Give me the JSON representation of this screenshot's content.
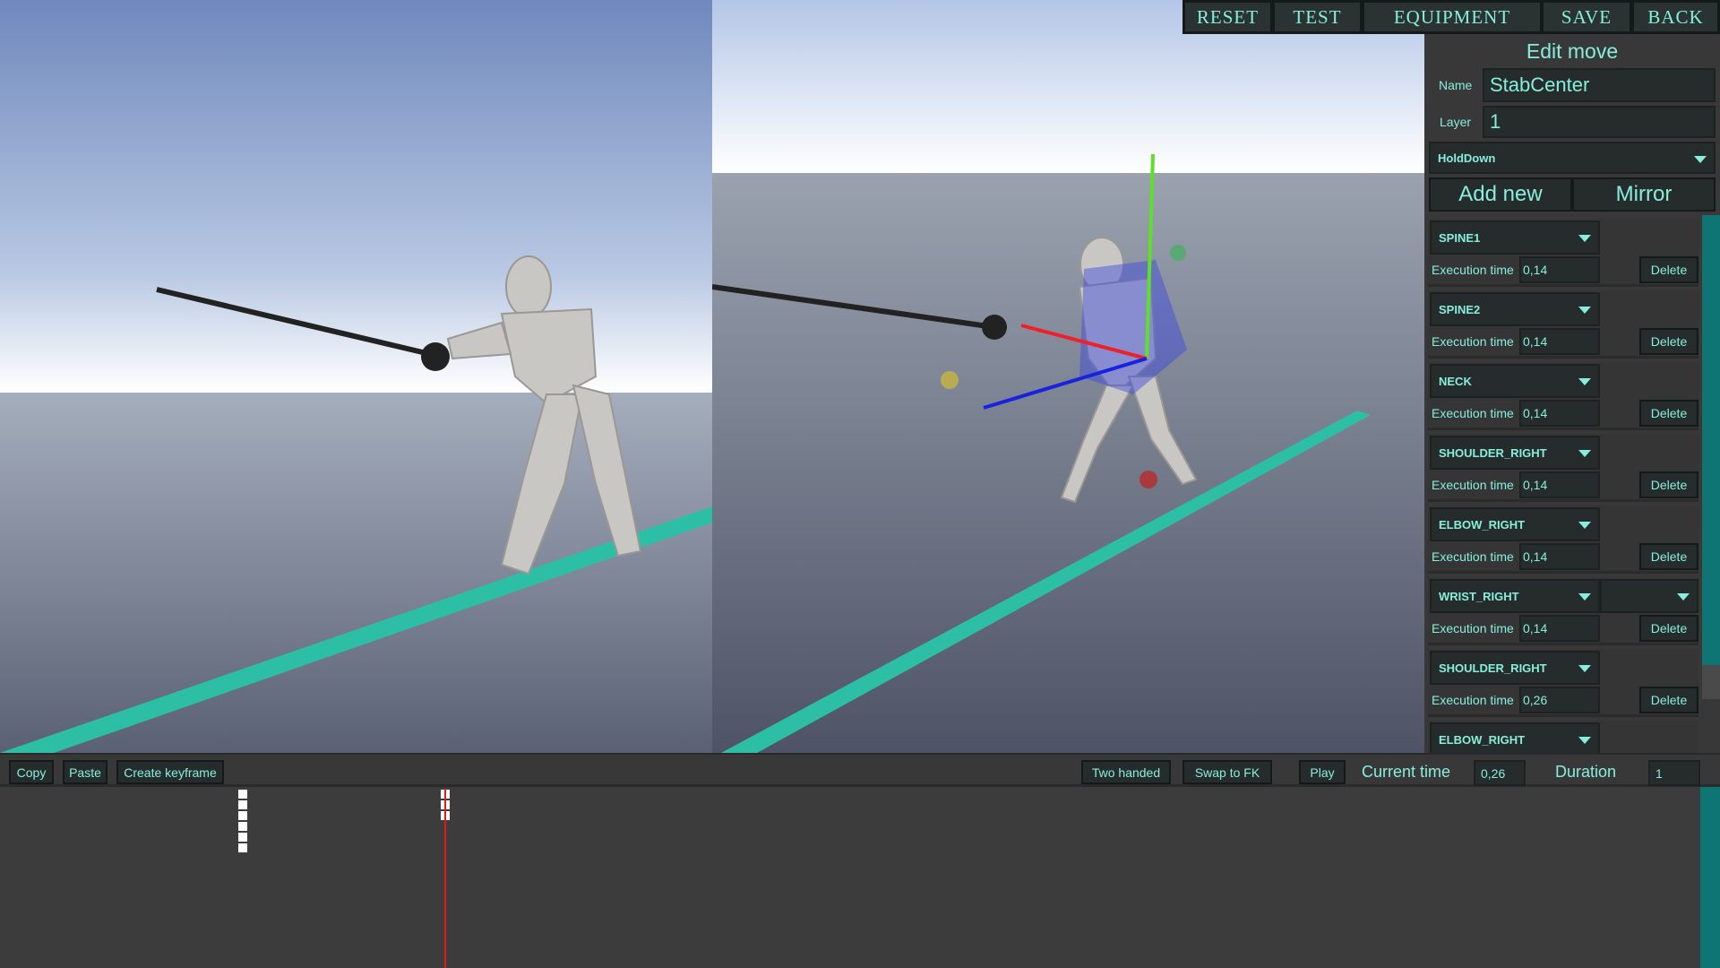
{
  "toolbar": {
    "reset": "RESET",
    "test": "TEST",
    "equipment": "EQUIPMENT",
    "save": "SAVE",
    "back": "BACK"
  },
  "panel": {
    "title": "Edit move",
    "name_label": "Name",
    "name_value": "StabCenter",
    "layer_label": "Layer",
    "layer_value": "1",
    "mode_value": "HoldDown",
    "add_new": "Add new",
    "mirror": "Mirror",
    "exec_label": "Execution time",
    "delete_label": "Delete",
    "items": [
      {
        "bone": "SPINE1",
        "time": "0,14"
      },
      {
        "bone": "SPINE2",
        "time": "0,14"
      },
      {
        "bone": "NECK",
        "time": "0,14"
      },
      {
        "bone": "SHOULDER_RIGHT",
        "time": "0,14"
      },
      {
        "bone": "ELBOW_RIGHT",
        "time": "0,14"
      },
      {
        "bone": "WRIST_RIGHT",
        "time": "0,14",
        "extra_dropdown": ""
      },
      {
        "bone": "SHOULDER_RIGHT",
        "time": "0,26"
      },
      {
        "bone": "ELBOW_RIGHT",
        "time": ""
      }
    ]
  },
  "bottombar": {
    "copy": "Copy",
    "paste": "Paste",
    "create_keyframe": "Create keyframe",
    "two_handed": "Two handed",
    "swap_fk": "Swap to FK",
    "play": "Play",
    "current_time_label": "Current time",
    "current_time": "0,26",
    "duration_label": "Duration",
    "duration": "1"
  },
  "timeline": {
    "keyframe_columns": [
      {
        "time": 0.14,
        "keys": 6
      },
      {
        "time": 0.26,
        "keys": 3
      }
    ],
    "playhead_time": 0.26
  },
  "colors": {
    "accent": "#86eedd",
    "panel": "#383838",
    "button": "#262c2b",
    "track": "#2dbfa6",
    "scrollbar": "#0e7474",
    "playhead": "#e01a1a"
  }
}
